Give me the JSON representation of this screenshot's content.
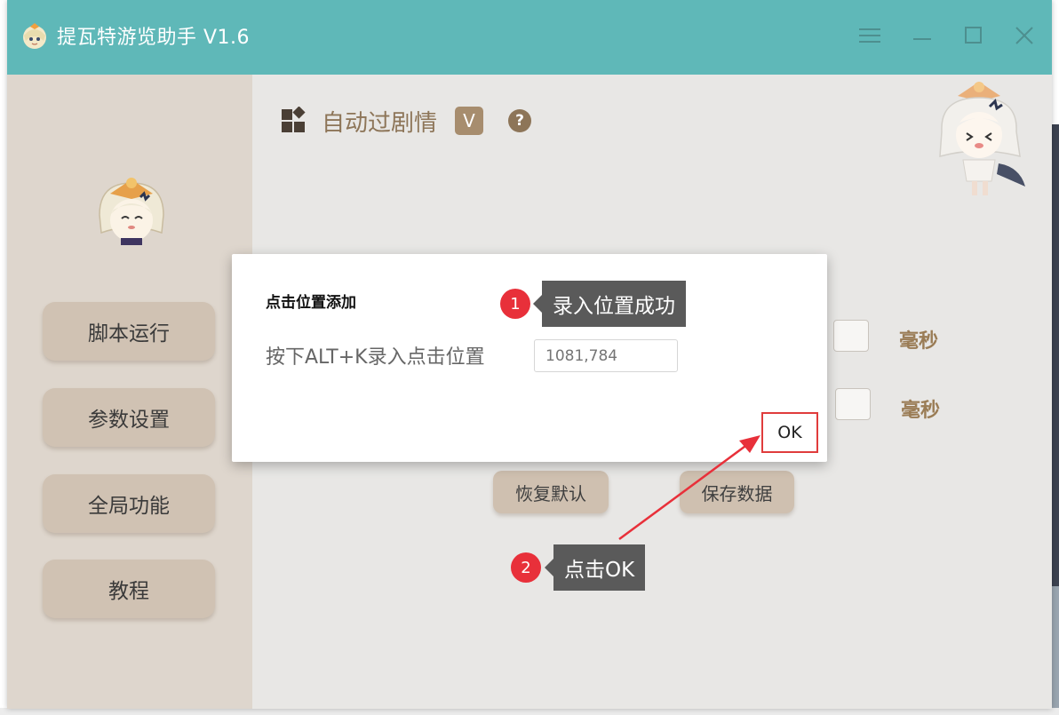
{
  "window": {
    "title": "提瓦特游览助手 V1.6"
  },
  "titlebar_icons": [
    "menu-icon",
    "minimize-icon",
    "maximize-icon",
    "close-icon"
  ],
  "sidebar": {
    "items": [
      {
        "label": "脚本运行"
      },
      {
        "label": "参数设置"
      },
      {
        "label": "全局功能"
      },
      {
        "label": "教程"
      }
    ]
  },
  "main": {
    "title": "自动过剧情",
    "badge": "V",
    "help": "?",
    "units": [
      "毫秒",
      "毫秒"
    ],
    "buttons": {
      "restore": "恢复默认",
      "save": "保存数据"
    }
  },
  "dialog": {
    "title": "点击位置添加",
    "label": "按下ALT+K录入点击位置",
    "input_placeholder": "1081,784",
    "ok": "OK"
  },
  "annotations": [
    {
      "number": "1",
      "text": "录入位置成功"
    },
    {
      "number": "2",
      "text": "点击OK"
    }
  ],
  "colors": {
    "titlebar": "#5fb8b8",
    "sidebar": "#ded6cd",
    "accent_brown": "#8d7558",
    "annotation_red": "#e8303a",
    "ok_outline": "#e03c3c"
  }
}
